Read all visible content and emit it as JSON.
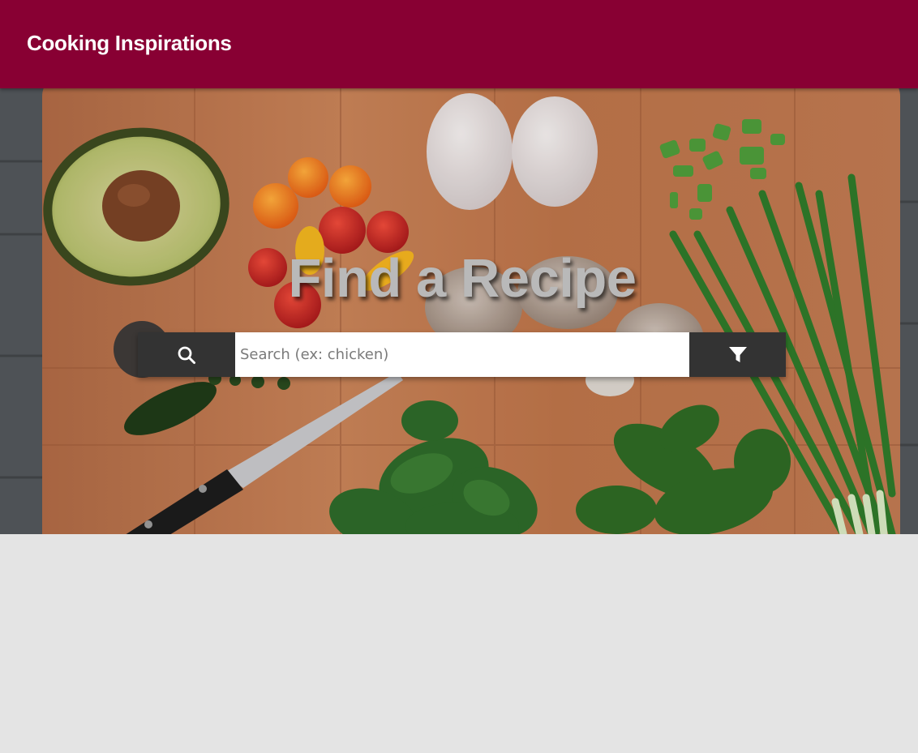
{
  "header": {
    "title": "Cooking Inspirations",
    "background_color": "#880033"
  },
  "hero": {
    "title": "Find a Recipe",
    "background_image": "cutting board with avocado, tomatoes, eggs, mushrooms, knife, spinach, green onions"
  },
  "search": {
    "placeholder": "Search (ex: chicken)",
    "value": "",
    "search_icon": "search-icon",
    "filter_icon": "filter-icon",
    "button_color": "#333333"
  },
  "page": {
    "background_color": "#e4e4e4"
  }
}
